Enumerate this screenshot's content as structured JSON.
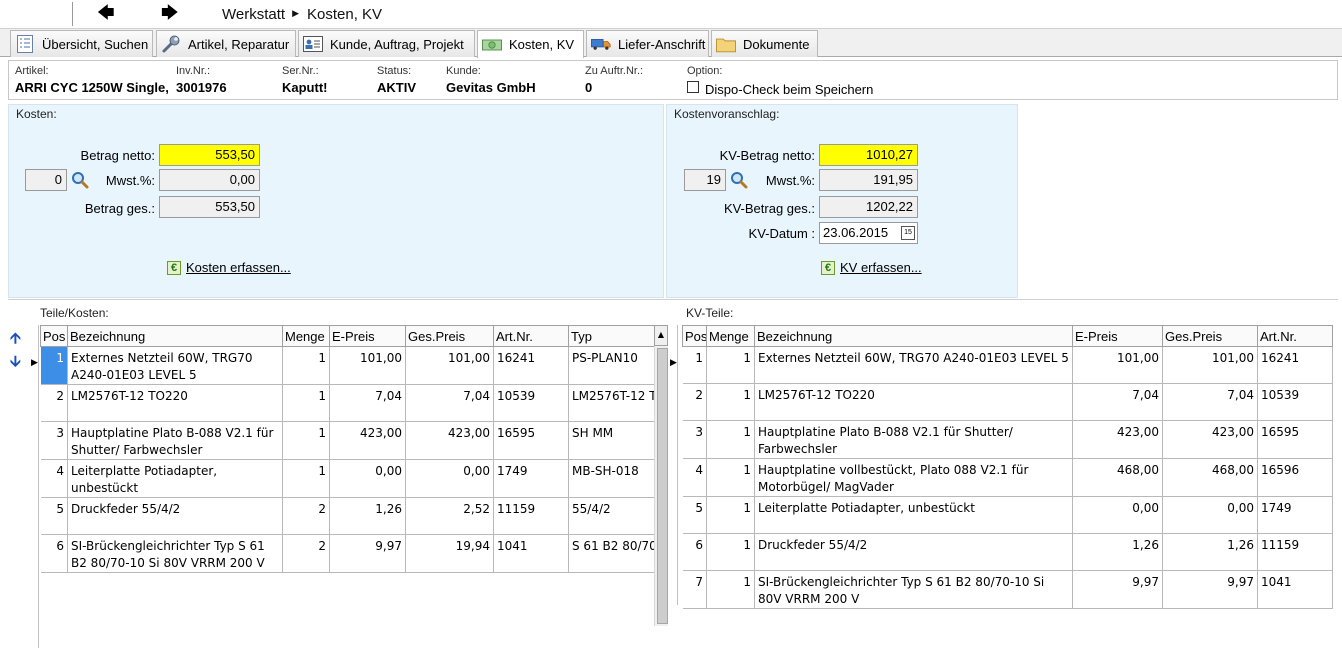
{
  "nav": {
    "back_icon": "arrow-left-icon",
    "forward_icon": "arrow-right-icon",
    "crumb_root": "Werkstatt",
    "crumb_current": "Kosten, KV"
  },
  "tabs": [
    {
      "label": "Übersicht, Suchen",
      "icon": "list-icon"
    },
    {
      "label": "Artikel, Reparatur",
      "icon": "wrench-icon"
    },
    {
      "label": "Kunde, Auftrag, Projekt",
      "icon": "contact-card-icon"
    },
    {
      "label": "Kosten, KV",
      "icon": "money-icon"
    },
    {
      "label": "Liefer-Anschrift",
      "icon": "truck-icon"
    },
    {
      "label": "Dokumente",
      "icon": "folder-icon"
    }
  ],
  "info": {
    "artikel_label": "Artikel:",
    "artikel": "ARRI CYC 1250W Single,",
    "invnr_label": "Inv.Nr.:",
    "invnr": "3001976",
    "sernr_label": "Ser.Nr.:",
    "sernr": "Kaputt!",
    "status_label": "Status:",
    "status": "AKTIV",
    "kunde_label": "Kunde:",
    "kunde": "Gevitas GmbH",
    "zuauftr_label": "Zu Auftr.Nr.:",
    "zuauftr": "0",
    "option_label": "Option:",
    "dispo_label": "Dispo-Check beim Speichern",
    "dispo_checked": false
  },
  "kosten": {
    "title": "Kosten:",
    "netto_label": "Betrag netto:",
    "netto": "553,50",
    "mwst_code": "0",
    "mwst_label": "Mwst.%:",
    "mwst": "0,00",
    "ges_label": "Betrag ges.:",
    "ges": "553,50",
    "link": "Kosten erfassen..."
  },
  "kv": {
    "title": "Kostenvoranschlag:",
    "netto_label": "KV-Betrag netto:",
    "netto": "1010,27",
    "mwst_code": "19",
    "mwst_label": "Mwst.%:",
    "mwst": "191,95",
    "ges_label": "KV-Betrag ges.:",
    "ges": "1202,22",
    "datum_label": "KV-Datum :",
    "datum": "23.06.2015",
    "cal_label": "15",
    "link": "KV erfassen..."
  },
  "teile": {
    "title": "Teile/Kosten:",
    "headers": [
      "Pos",
      "Bezeichnung",
      "Menge",
      "E-Preis",
      "Ges.Preis",
      "Art.Nr.",
      "Typ"
    ],
    "rows": [
      [
        "1",
        "Externes Netzteil 60W, TRG70 A240-01E03 LEVEL 5",
        "1",
        "101,00",
        "101,00",
        "16241",
        "PS-PLAN10"
      ],
      [
        "2",
        "LM2576T-12 TO220",
        "1",
        "7,04",
        "7,04",
        "10539",
        "LM2576T-12 T"
      ],
      [
        "3",
        "Hauptplatine Plato B-088 V2.1 für Shutter/ Farbwechsler",
        "1",
        "423,00",
        "423,00",
        "16595",
        "SH MM"
      ],
      [
        "4",
        "Leiterplatte Potiadapter, unbestückt",
        "1",
        "0,00",
        "0,00",
        "1749",
        "MB-SH-018"
      ],
      [
        "5",
        "Druckfeder 55/4/2",
        "2",
        "1,26",
        "2,52",
        "11159",
        "55/4/2"
      ],
      [
        "6",
        "SI-Brückengleichrichter Typ S 61 B2 80/70-10 Si 80V VRRM 200 V",
        "2",
        "9,97",
        "19,94",
        "1041",
        "S 61 B2 80/70-"
      ]
    ]
  },
  "kvteile": {
    "title": "KV-Teile:",
    "headers": [
      "Pos",
      "Menge",
      "Bezeichnung",
      "E-Preis",
      "Ges.Preis",
      "Art.Nr."
    ],
    "rows": [
      [
        "1",
        "1",
        "Externes Netzteil 60W, TRG70 A240-01E03 LEVEL 5",
        "101,00",
        "101,00",
        "16241"
      ],
      [
        "2",
        "1",
        "LM2576T-12 TO220",
        "7,04",
        "7,04",
        "10539"
      ],
      [
        "3",
        "1",
        "Hauptplatine Plato B-088 V2.1 für Shutter/ Farbwechsler",
        "423,00",
        "423,00",
        "16595"
      ],
      [
        "4",
        "1",
        "Hauptplatine vollbestückt, Plato 088 V2.1 für Motorbügel/ MagVader",
        "468,00",
        "468,00",
        "16596"
      ],
      [
        "5",
        "1",
        "Leiterplatte Potiadapter, unbestückt",
        "0,00",
        "0,00",
        "1749"
      ],
      [
        "6",
        "1",
        "Druckfeder 55/4/2",
        "1,26",
        "1,26",
        "11159"
      ],
      [
        "7",
        "1",
        "SI-Brückengleichrichter Typ S 61 B2 80/70-10 Si 80V VRRM 200 V",
        "9,97",
        "9,97",
        "1041"
      ]
    ]
  }
}
